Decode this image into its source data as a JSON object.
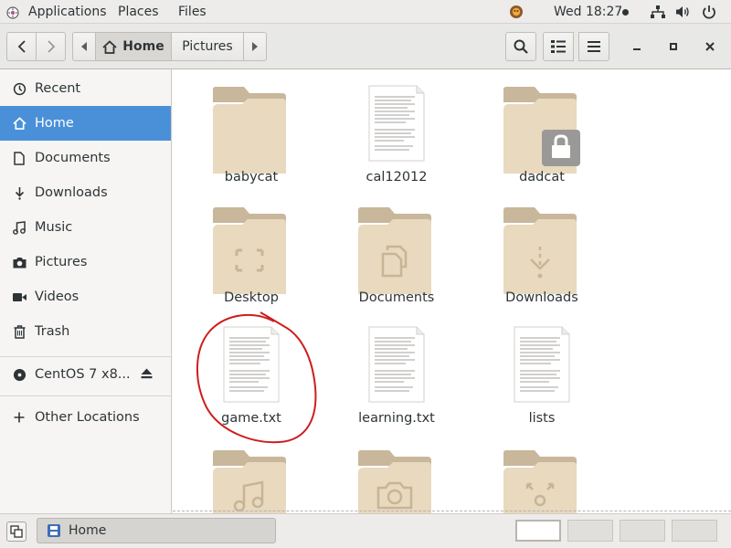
{
  "topbar": {
    "applications": "Applications",
    "places": "Places",
    "files": "Files",
    "clock": "Wed 18:27",
    "icons": [
      "apps-icon",
      "weather-icon",
      "network-icon",
      "volume-icon",
      "power-icon"
    ]
  },
  "header": {
    "path": {
      "home": "Home",
      "pictures": "Pictures"
    },
    "icons": [
      "back-icon",
      "forward-icon",
      "home-icon",
      "search-icon",
      "view-icon",
      "menu-icon",
      "minimize-icon",
      "maximize-icon",
      "close-icon"
    ]
  },
  "sidebar": {
    "items": [
      {
        "label": "Recent",
        "icon": "clock-icon"
      },
      {
        "label": "Home",
        "icon": "home-icon",
        "active": true
      },
      {
        "label": "Documents",
        "icon": "document-icon"
      },
      {
        "label": "Downloads",
        "icon": "download-icon"
      },
      {
        "label": "Music",
        "icon": "music-icon"
      },
      {
        "label": "Pictures",
        "icon": "camera-icon"
      },
      {
        "label": "Videos",
        "icon": "video-icon"
      },
      {
        "label": "Trash",
        "icon": "trash-icon"
      }
    ],
    "device": {
      "label": "CentOS 7 x8...",
      "icon": "disc-icon"
    },
    "other": {
      "label": "Other Locations",
      "icon": "plus-icon"
    }
  },
  "content": {
    "items": [
      {
        "name": "babycat",
        "kind": "folder"
      },
      {
        "name": "cal12012",
        "kind": "text-file"
      },
      {
        "name": "dadcat",
        "kind": "folder-locked"
      },
      {
        "name": "Desktop",
        "kind": "folder-desktop"
      },
      {
        "name": "Documents",
        "kind": "folder-documents"
      },
      {
        "name": "Downloads",
        "kind": "folder-downloads"
      },
      {
        "name": "game.txt",
        "kind": "text-file",
        "annotated": true
      },
      {
        "name": "learning.txt",
        "kind": "text-file"
      },
      {
        "name": "lists",
        "kind": "text-file"
      },
      {
        "name": "",
        "kind": "folder-music"
      },
      {
        "name": "",
        "kind": "folder-pictures"
      },
      {
        "name": "",
        "kind": "folder-shared"
      }
    ]
  },
  "taskbar": {
    "window": "Home",
    "workspaces": 4,
    "active_workspace": 1
  },
  "colors": {
    "accent": "#4a90d9",
    "folder": "#e8d9bf",
    "folder_tab": "#c8b79a",
    "annotation": "#cc1f1f"
  }
}
